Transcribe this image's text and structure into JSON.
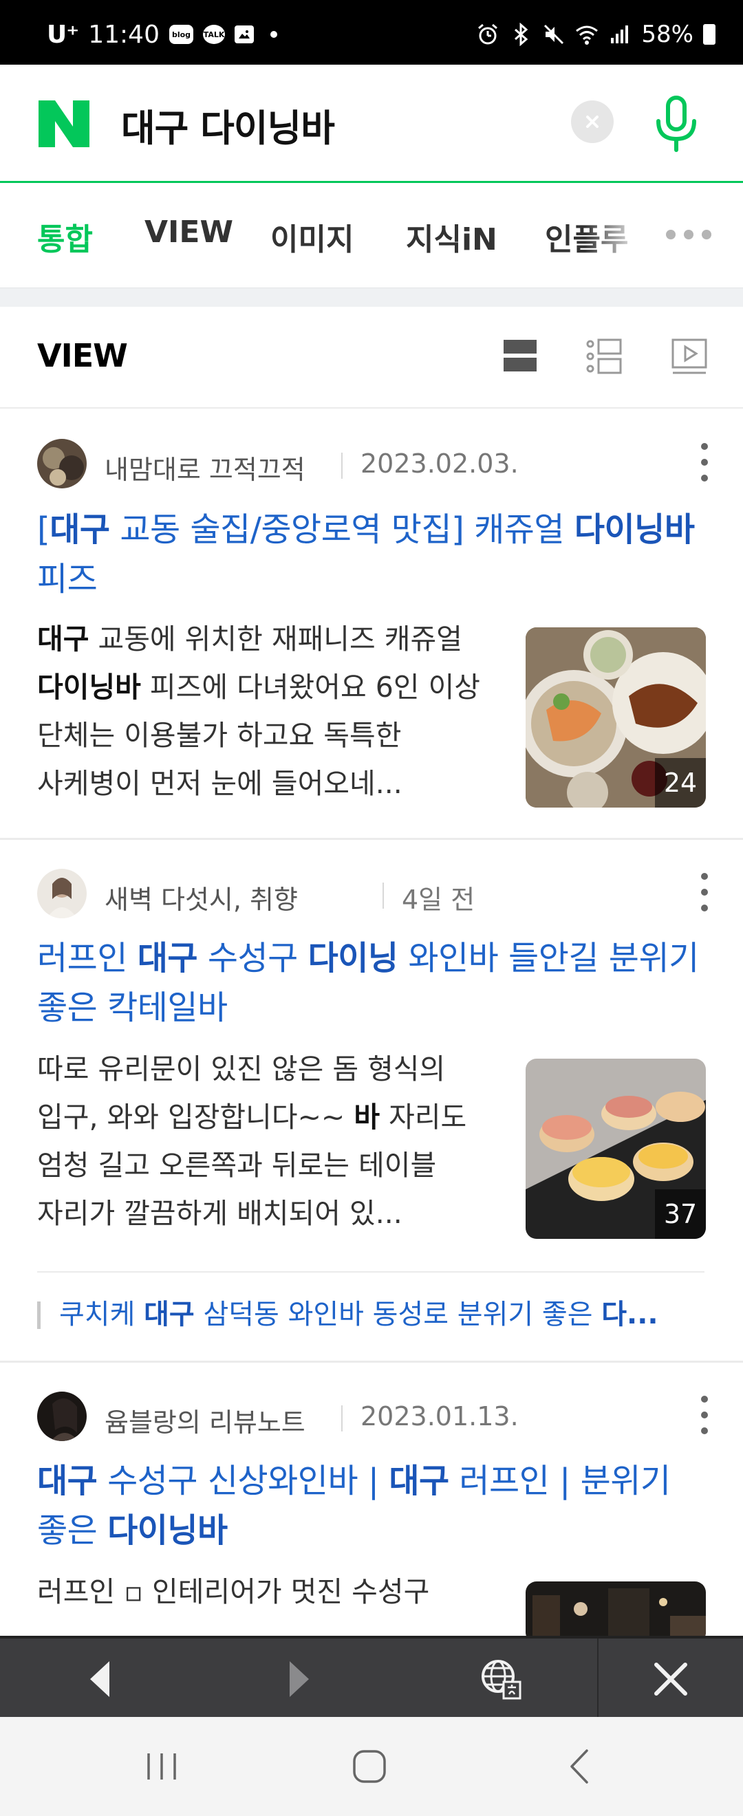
{
  "status_bar": {
    "carrier": "U⁺",
    "time": "11:40",
    "badge_blog": "blog",
    "badge_talk": "TALK",
    "battery": "58%"
  },
  "search": {
    "query": "대구 다이닝바",
    "brand_color": "#03c75a"
  },
  "tabs": [
    {
      "label": "통합",
      "active": true
    },
    {
      "label": "VIEW",
      "active": false
    },
    {
      "label": "이미지",
      "active": false
    },
    {
      "label": "지식iN",
      "active": false
    },
    {
      "label": "인플루",
      "active": false
    }
  ],
  "view_section": {
    "title": "VIEW"
  },
  "articles": [
    {
      "author": "내맘대로 끄적끄적",
      "date": "2023.02.03.",
      "title_parts": [
        {
          "t": "[",
          "b": false
        },
        {
          "t": "대구",
          "b": true
        },
        {
          "t": " 교동 술집/중앙로역 맛집] 캐쥬얼 ",
          "b": false
        },
        {
          "t": "다이닝바",
          "b": true
        },
        {
          "t": " 피즈",
          "b": false
        }
      ],
      "body_parts": [
        {
          "t": "대구",
          "b": true
        },
        {
          "t": " 교동에 위치한 재패니즈 캐쥬얼 ",
          "b": false
        },
        {
          "t": "다이닝바",
          "b": true
        },
        {
          "t": " 피즈에 다녀왔어요 6인 이상 단체는 이용불가 하고요 독특한 사케병이 먼저 눈에 들어오네...",
          "b": false
        }
      ],
      "thumb_count": "24"
    },
    {
      "author": "새벽 다섯시, 취향",
      "date": "4일 전",
      "title_parts": [
        {
          "t": "러프인 ",
          "b": false
        },
        {
          "t": "대구",
          "b": true
        },
        {
          "t": " 수성구 ",
          "b": false
        },
        {
          "t": "다이닝",
          "b": true
        },
        {
          "t": " 와인바 들안길 분위기 좋은 칵테일바",
          "b": false
        }
      ],
      "body_parts": [
        {
          "t": "따로 유리문이 있진 않은 돔 형식의 입구, 와와 입장합니다~~ ",
          "b": false
        },
        {
          "t": "바",
          "b": true
        },
        {
          "t": " 자리도 엄청 길고 오른쪽과 뒤로는 테이블 자리가 깔끔하게 배치되어 있...",
          "b": false
        }
      ],
      "thumb_count": "37",
      "related": [
        {
          "t": "쿠치케 ",
          "b": false
        },
        {
          "t": "대구",
          "b": true
        },
        {
          "t": " 삼덕동 와인바 동성로 분위기 좋은 ",
          "b": false
        },
        {
          "t": "다...",
          "b": true
        }
      ]
    },
    {
      "author": "윰블랑의 리뷰노트",
      "date": "2023.01.13.",
      "title_parts": [
        {
          "t": "대구",
          "b": true
        },
        {
          "t": " 수성구 신상와인바 | ",
          "b": false
        },
        {
          "t": "대구",
          "b": true
        },
        {
          "t": " 러프인 | 분위기 좋은 ",
          "b": false
        },
        {
          "t": "다이닝바",
          "b": true
        }
      ],
      "body_parts": [
        {
          "t": "러프인 ",
          "b": false
        },
        {
          "t": "▫",
          "b": false
        },
        {
          "t": " 인테리어가 멋진 수성구",
          "b": false
        }
      ]
    }
  ],
  "icons": {
    "back": "chevron-left-icon",
    "forward": "chevron-right-icon",
    "translate": "globe-icon",
    "close": "close-icon"
  }
}
